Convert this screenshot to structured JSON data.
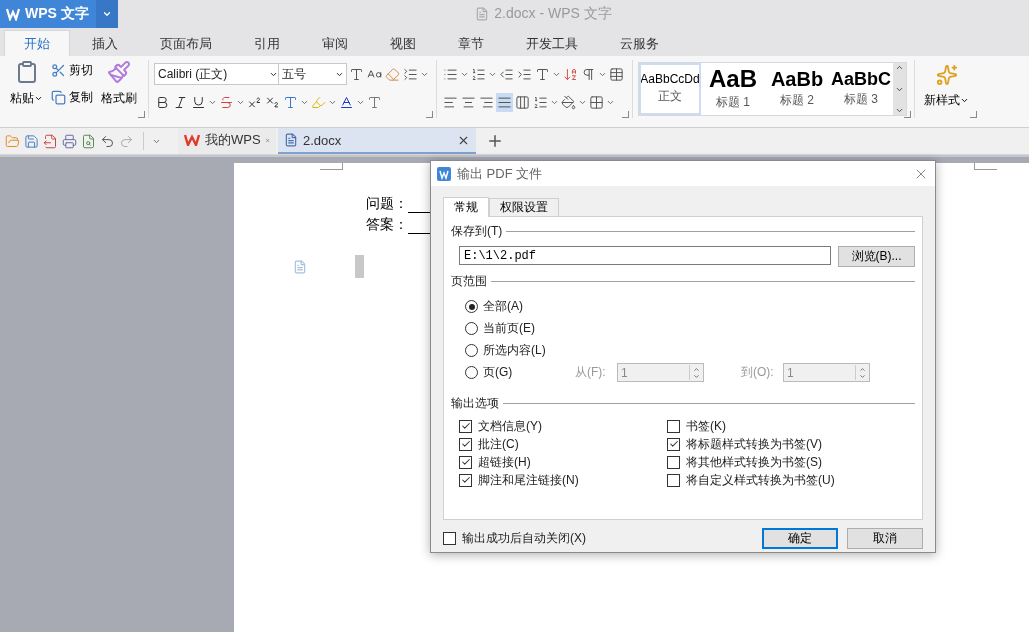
{
  "app_button": {
    "label": "WPS 文字"
  },
  "window": {
    "title": "2.docx - WPS 文字"
  },
  "ribbon_tabs": [
    {
      "label": "开始",
      "selected": true
    },
    {
      "label": "插入",
      "selected": false
    },
    {
      "label": "页面布局",
      "selected": false
    },
    {
      "label": "引用",
      "selected": false
    },
    {
      "label": "审阅",
      "selected": false
    },
    {
      "label": "视图",
      "selected": false
    },
    {
      "label": "章节",
      "selected": false
    },
    {
      "label": "开发工具",
      "selected": false
    },
    {
      "label": "云服务",
      "selected": false
    }
  ],
  "clipboard": {
    "paste": "粘贴",
    "cut": "剪切",
    "copy": "复制",
    "format_painter": "格式刷"
  },
  "font": {
    "name": "Calibri (正文)",
    "size": "五号"
  },
  "styles": [
    {
      "sample": "AaBbCcDd",
      "label": "正文",
      "selected": true,
      "kind": "body"
    },
    {
      "sample": "AaB",
      "label": "标题 1",
      "selected": false,
      "kind": "h1"
    },
    {
      "sample": "AaBb",
      "label": "标题 2",
      "selected": false,
      "kind": "h2"
    },
    {
      "sample": "AaBbC",
      "label": "标题 3",
      "selected": false,
      "kind": "h3"
    }
  ],
  "new_style": "新样式",
  "doc_tabs": [
    {
      "label": "我的WPS",
      "selected": false,
      "kind": "home"
    },
    {
      "label": "2.docx",
      "selected": true,
      "kind": "doc"
    }
  ],
  "document": {
    "lines": [
      "问题：",
      "答案："
    ]
  },
  "dialog": {
    "title": "输出 PDF 文件",
    "tabs": [
      {
        "label": "常规",
        "selected": true
      },
      {
        "label": "权限设置",
        "selected": false
      }
    ],
    "save_to": {
      "legend": "保存到(T)",
      "value": "E:\\1\\2.pdf",
      "browse": "浏览(B)..."
    },
    "page_range": {
      "legend": "页范围",
      "options": [
        {
          "label": "全部(A)",
          "selected": true,
          "kind": "simple"
        },
        {
          "label": "当前页(E)",
          "selected": false,
          "kind": "simple"
        },
        {
          "label": "所选内容(L)",
          "selected": false,
          "kind": "simple"
        },
        {
          "label": "页(G)",
          "selected": false,
          "kind": "pages",
          "from_label": "从(F):",
          "from_value": "1",
          "to_label": "到(O):",
          "to_value": "1",
          "disabled": true
        }
      ]
    },
    "output_options": {
      "legend": "输出选项",
      "items": [
        {
          "label": "文档信息(Y)",
          "checked": true
        },
        {
          "label": "书签(K)",
          "checked": false
        },
        {
          "label": "批注(C)",
          "checked": true
        },
        {
          "label": "将标题样式转换为书签(V)",
          "checked": true
        },
        {
          "label": "超链接(H)",
          "checked": true
        },
        {
          "label": "将其他样式转换为书签(S)",
          "checked": false
        },
        {
          "label": "脚注和尾注链接(N)",
          "checked": true
        },
        {
          "label": "将自定义样式转换为书签(U)",
          "checked": false
        }
      ]
    },
    "auto_close": {
      "label": "输出成功后自动关闭(X)",
      "checked": false
    },
    "buttons": [
      {
        "label": "确定",
        "kind": "primary"
      },
      {
        "label": "取消",
        "kind": "default"
      }
    ]
  }
}
